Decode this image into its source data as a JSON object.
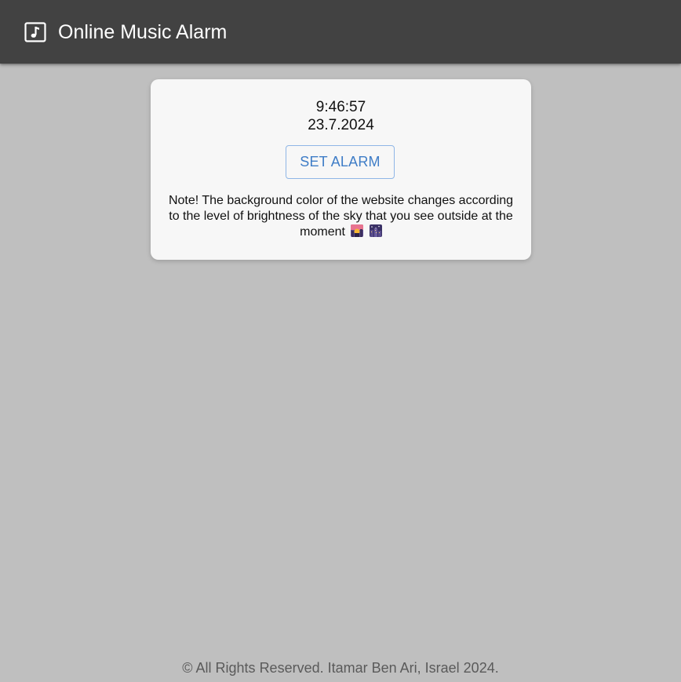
{
  "header": {
    "title": "Online Music Alarm",
    "icon": "music-note-icon",
    "background": "#424242"
  },
  "clock": {
    "time": "9:46:57",
    "date": "23.7.2024"
  },
  "alarm": {
    "button_label": "SET ALARM",
    "accent": "#3f7dc7"
  },
  "note": {
    "text": "Note! The background color of the website changes according to the level of brightness of the sky that you see outside at the moment",
    "emojis": [
      "sunset-icon",
      "night-city-icon"
    ]
  },
  "footer": {
    "text": "© All Rights Reserved. Itamar Ben Ari, Israel 2024."
  },
  "colors": {
    "page_background": "#bfbfbf",
    "card_background": "#f7f7f7"
  }
}
